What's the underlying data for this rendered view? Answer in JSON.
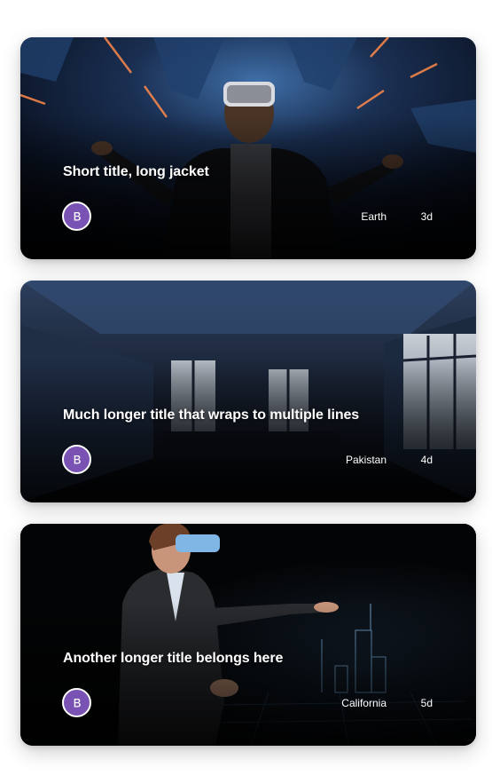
{
  "brand": {
    "color": "#7952b3",
    "icon": "bootstrap-icon"
  },
  "cards": [
    {
      "title": "Short title, long jacket",
      "location": "Earth",
      "age": "3d"
    },
    {
      "title": "Much longer title that wraps to multiple lines",
      "location": "Pakistan",
      "age": "4d"
    },
    {
      "title": "Another longer title belongs here",
      "location": "California",
      "age": "5d"
    }
  ]
}
